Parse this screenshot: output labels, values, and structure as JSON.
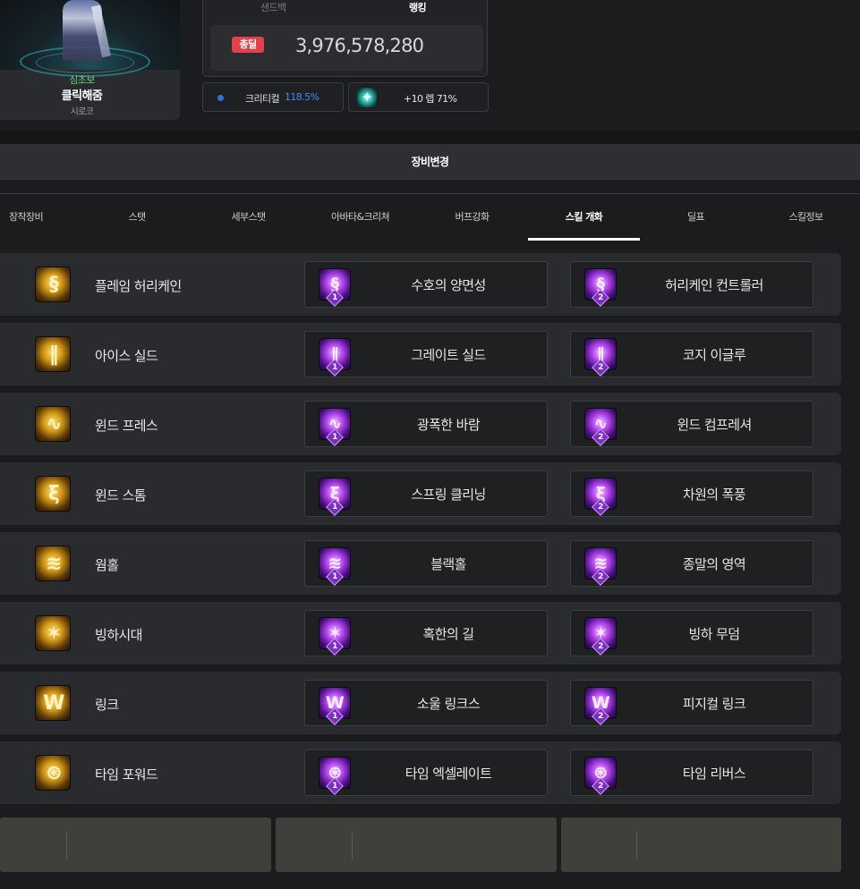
{
  "character": {
    "class": "심초보",
    "name": "클릭해줌",
    "server": "시로코"
  },
  "ranking": {
    "tab_sandbag": "샌드백",
    "tab_ranking": "랭킹",
    "badge": "총딜",
    "total_damage": "3,976,578,280"
  },
  "stats": {
    "crit_label": "크리티컬",
    "crit_value": "118.5%",
    "enchant_text": "+10 렙 71%",
    "crit_dot_color": "#2f6ff0"
  },
  "equip_button": "장비변경",
  "tabs": [
    {
      "label": "장착장비"
    },
    {
      "label": "스탯"
    },
    {
      "label": "세부스탯"
    },
    {
      "label": "아바타&크리쳐"
    },
    {
      "label": "버프강화"
    },
    {
      "label": "스킬 개화"
    },
    {
      "label": "딜표"
    },
    {
      "label": "스킬정보"
    }
  ],
  "active_tab": "스킬 개화",
  "skills": [
    {
      "name": "플레임 허리케인",
      "icon": "flame-hurricane-icon",
      "enh1": "수호의 양면성",
      "enh2": "허리케인 컨트롤러"
    },
    {
      "name": "아이스 실드",
      "icon": "ice-shield-icon",
      "enh1": "그레이트 실드",
      "enh2": "코지 이글루"
    },
    {
      "name": "윈드 프레스",
      "icon": "wind-press-icon",
      "enh1": "광폭한 바람",
      "enh2": "윈드 컴프레셔"
    },
    {
      "name": "윈드 스톰",
      "icon": "wind-storm-icon",
      "enh1": "스프링 클리닝",
      "enh2": "차원의 폭풍"
    },
    {
      "name": "웜홀",
      "icon": "wormhole-icon",
      "enh1": "블랙홀",
      "enh2": "종말의 영역"
    },
    {
      "name": "빙하시대",
      "icon": "ice-age-icon",
      "enh1": "혹한의 길",
      "enh2": "빙하 무덤"
    },
    {
      "name": "링크",
      "icon": "link-icon",
      "enh1": "소울 링크스",
      "enh2": "피지컬 링크"
    },
    {
      "name": "타임 포워드",
      "icon": "time-forward-icon",
      "enh1": "타임 엑셀레이트",
      "enh2": "타임 리버스"
    }
  ],
  "enh_badge": [
    "1",
    "2"
  ],
  "colors": {
    "damage_badge": "#e0414a",
    "crit_value": "#3b8bff",
    "class_text": "#6fcf7a",
    "base_icon": "#d59b18",
    "enh_icon": "#b548f0"
  }
}
